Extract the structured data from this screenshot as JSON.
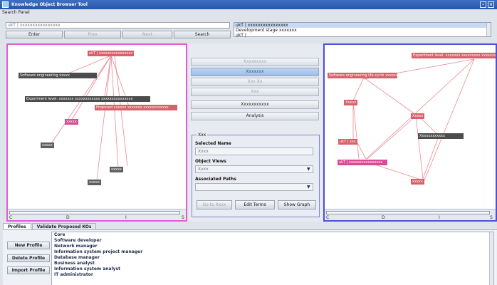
{
  "window": {
    "title": "Knowledge Object Browser Tool",
    "buttons": [
      "–",
      "×"
    ]
  },
  "search": {
    "panel_label": "Search Panel",
    "query": "ukT | xxxxxxxxxxxxxxxx",
    "buttons": {
      "enter": "Enter",
      "prev": "Prev",
      "next": "Next",
      "search": "Search"
    },
    "results": [
      "ukT | xxxxxxxxxxxxxxxx",
      "Development stage xxxxxxx",
      "ukT | "
    ]
  },
  "left_graph": {
    "nodes": [
      {
        "label": "ukT | xxxxxxxxxxxxxxxx",
        "style": "red"
      },
      {
        "label": "Software engineering xxxxx",
        "style": "dark"
      },
      {
        "label": "Experiment level: xxxxxxx xxxxxxxxxxxx xxxxxxxxxxxxxxx",
        "style": "dark"
      },
      {
        "label": "Proposed xxxxxx xxxxxxx xxxxxxxxxxxx",
        "style": "red"
      },
      {
        "label": "xxxxx",
        "style": "pink"
      },
      {
        "label": "xxxxx",
        "style": "grey"
      },
      {
        "label": "xxxxx",
        "style": "grey"
      },
      {
        "label": "xxxxx",
        "style": "grey"
      }
    ],
    "axis_ticks": [
      "C",
      "D",
      "I",
      "S"
    ]
  },
  "middle": {
    "buttons": [
      {
        "label": "Xxxxxxxxx",
        "state": "disabled"
      },
      {
        "label": "Xxxxxxx",
        "state": "highlight"
      },
      {
        "label": "Xxx  Xx",
        "state": "disabled"
      },
      {
        "label": "Xxx",
        "state": "disabled"
      },
      {
        "label": "Xxxxxxxxxxx",
        "state": "active"
      },
      {
        "label": "Analysis",
        "state": "active"
      }
    ],
    "form": {
      "legend": "Xxx",
      "fields": [
        {
          "label": "Selected Name",
          "value": "Xxxx"
        },
        {
          "label": "Object Views",
          "value": "Xxxx"
        },
        {
          "label": "Associated Paths",
          "value": ""
        }
      ],
      "buttons": {
        "go_back": "Go to Xxxx",
        "edit_terms": "Edit Terms",
        "show_graph": "Show Graph"
      }
    }
  },
  "right_graph": {
    "nodes": [
      {
        "label": "Experiment level: xxxxxxx xxxxxxxxx xxxxxxxx",
        "style": "red"
      },
      {
        "label": "Software engineering life-cycle xxxxxxxx",
        "style": "red"
      },
      {
        "label": "Xxxxx",
        "style": "red"
      },
      {
        "label": "Xxxxx",
        "style": "red"
      },
      {
        "label": "Xxxxxxxxxxxx",
        "style": "dark"
      },
      {
        "label": "ukT | xxx",
        "style": "red"
      },
      {
        "label": "ukT | xxxxxxxxxxxxxxxx",
        "style": "pink"
      },
      {
        "label": "xxxxx",
        "style": "red"
      }
    ],
    "axis_ticks": [
      "C",
      "D",
      "I",
      "S"
    ]
  },
  "bottom": {
    "tabs": [
      "Profiles",
      "Validate Proposed KOs"
    ],
    "buttons": [
      "New Profile",
      "Delete Profile",
      "Import Profile"
    ],
    "profiles": [
      "Core",
      "Software developer",
      "Network manager",
      "Information system project manager",
      "Database manager",
      "Business analyst",
      "Information system analyst",
      "IT administrator"
    ]
  },
  "colors": {
    "left_border": "#e35ad8",
    "right_border": "#4b52d6",
    "node_red": "#d9606a",
    "node_dark": "#4c4c4c",
    "node_pink": "#db4a94"
  }
}
